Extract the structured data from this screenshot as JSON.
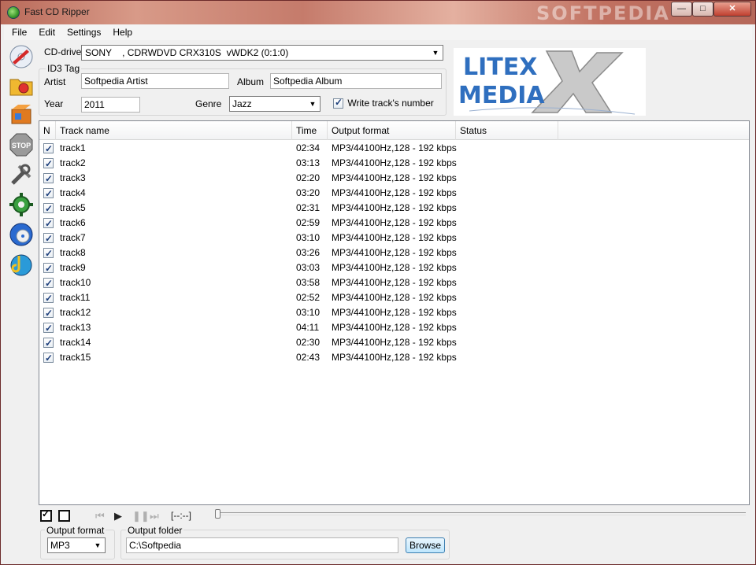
{
  "window": {
    "title": "Fast CD Ripper",
    "watermark": "SOFTPEDIA"
  },
  "menu": [
    "File",
    "Edit",
    "Settings",
    "Help"
  ],
  "toolbar_icons": [
    "cd-rip-icon",
    "folder-icon",
    "package-icon",
    "stop-icon",
    "tools-icon",
    "gear-icon",
    "cd-web-icon",
    "cd-music-icon"
  ],
  "cd": {
    "label": "CD-drive",
    "drive": "SONY    , CDRWDVD CRX310S  vWDK2 (0:1:0)"
  },
  "id3": {
    "group_title": "ID3 Tag",
    "artist_label": "Artist",
    "artist": "Softpedia Artist",
    "album_label": "Album",
    "album": "Softpedia Album",
    "year_label": "Year",
    "year": "2011",
    "genre_label": "Genre",
    "genre": "Jazz",
    "write_track_label": "Write track's number"
  },
  "logo": {
    "line1": "LITEX",
    "line2": "MEDIA"
  },
  "list": {
    "columns": {
      "n": "N",
      "name": "Track name",
      "time": "Time",
      "format": "Output format",
      "status": "Status"
    },
    "tracks": [
      {
        "name": "track1",
        "time": "02:34",
        "format": "MP3/44100Hz,128 - 192 kbps",
        "status": ""
      },
      {
        "name": "track2",
        "time": "03:13",
        "format": "MP3/44100Hz,128 - 192 kbps",
        "status": ""
      },
      {
        "name": "track3",
        "time": "02:20",
        "format": "MP3/44100Hz,128 - 192 kbps",
        "status": ""
      },
      {
        "name": "track4",
        "time": "03:20",
        "format": "MP3/44100Hz,128 - 192 kbps",
        "status": ""
      },
      {
        "name": "track5",
        "time": "02:31",
        "format": "MP3/44100Hz,128 - 192 kbps",
        "status": ""
      },
      {
        "name": "track6",
        "time": "02:59",
        "format": "MP3/44100Hz,128 - 192 kbps",
        "status": ""
      },
      {
        "name": "track7",
        "time": "03:10",
        "format": "MP3/44100Hz,128 - 192 kbps",
        "status": ""
      },
      {
        "name": "track8",
        "time": "03:26",
        "format": "MP3/44100Hz,128 - 192 kbps",
        "status": ""
      },
      {
        "name": "track9",
        "time": "03:03",
        "format": "MP3/44100Hz,128 - 192 kbps",
        "status": ""
      },
      {
        "name": "track10",
        "time": "03:58",
        "format": "MP3/44100Hz,128 - 192 kbps",
        "status": ""
      },
      {
        "name": "track11",
        "time": "02:52",
        "format": "MP3/44100Hz,128 - 192 kbps",
        "status": ""
      },
      {
        "name": "track12",
        "time": "03:10",
        "format": "MP3/44100Hz,128 - 192 kbps",
        "status": ""
      },
      {
        "name": "track13",
        "time": "04:11",
        "format": "MP3/44100Hz,128 - 192 kbps",
        "status": ""
      },
      {
        "name": "track14",
        "time": "02:30",
        "format": "MP3/44100Hz,128 - 192 kbps",
        "status": ""
      },
      {
        "name": "track15",
        "time": "02:43",
        "format": "MP3/44100Hz,128 - 192 kbps",
        "status": ""
      }
    ]
  },
  "player": {
    "time_display": "[--:--]"
  },
  "output": {
    "format_label": "Output format",
    "format": "MP3",
    "folder_label": "Output folder",
    "folder": "C:\\Softpedia",
    "browse_label": "Browse"
  }
}
